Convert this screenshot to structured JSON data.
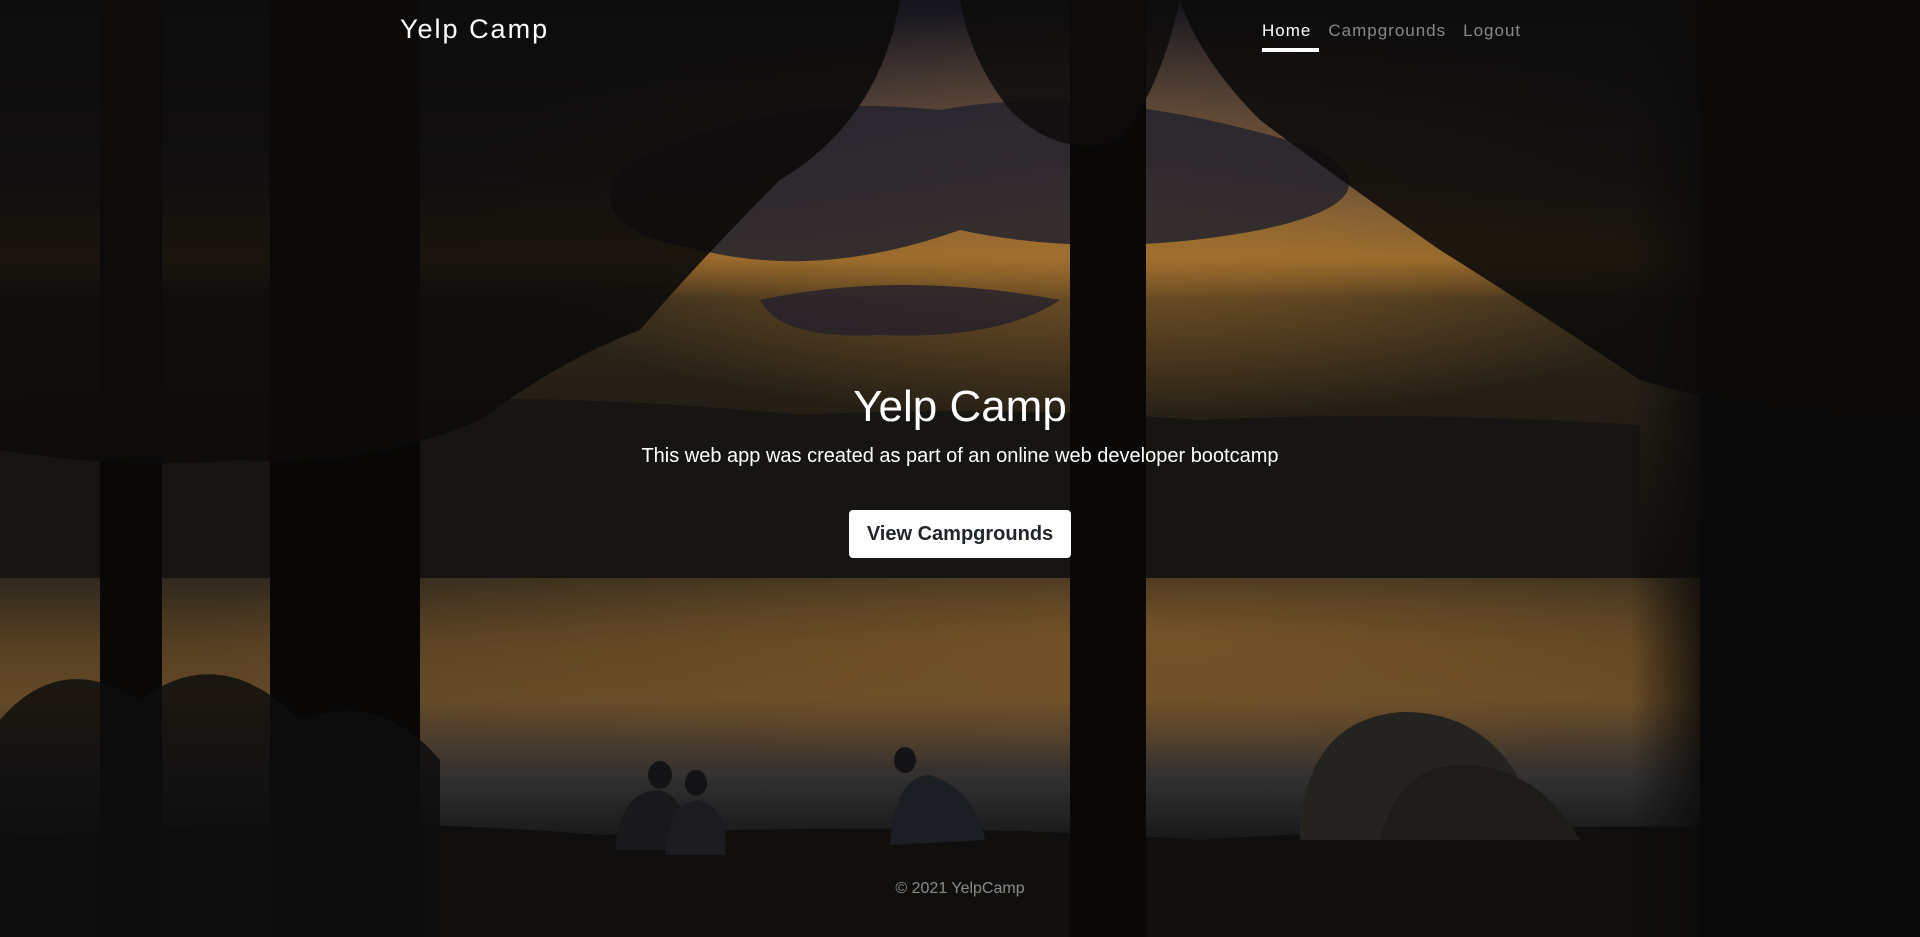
{
  "navbar": {
    "brand": "Yelp Camp",
    "links": [
      {
        "label": "Home",
        "active": true
      },
      {
        "label": "Campgrounds",
        "active": false
      },
      {
        "label": "Logout",
        "active": false
      }
    ]
  },
  "hero": {
    "title": "Yelp Camp",
    "lead": "This web app was created as part of an online web developer bootcamp",
    "button_label": "View Campgrounds"
  },
  "footer": {
    "text": "© 2021 YelpCamp"
  },
  "colors": {
    "text": "#ffffff",
    "muted_text": "rgba(255,255,255,0.5)",
    "button_bg": "#ffffff",
    "button_text": "#212529",
    "sky_glow": "#c8862f",
    "night": "#0c0b0a"
  },
  "background_image": "campsite-lake-sunset-photo"
}
